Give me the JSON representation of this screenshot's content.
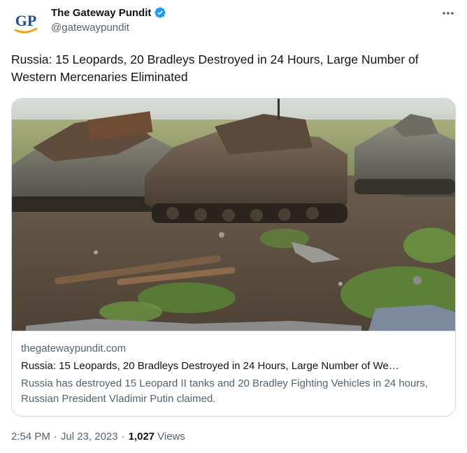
{
  "author": {
    "avatar_text": "GP",
    "display_name": "The Gateway Pundit",
    "handle": "@gatewaypundit",
    "verified_icon": "verified-badge-icon",
    "verified_color": "#1d9bf0"
  },
  "more_icon": "more-dots-icon",
  "tweet": {
    "text": "Russia: 15 Leopards, 20 Bradleys Destroyed in 24 Hours, Large Number of Western Mercenaries Eliminated"
  },
  "card": {
    "image": "photo of destroyed armored vehicles in a field",
    "domain": "thegatewaypundit.com",
    "title": "Russia: 15 Leopards, 20 Bradleys Destroyed in 24 Hours, Large Number of We…",
    "description": "Russia has destroyed 15 Leopard II tanks and 20 Bradley Fighting Vehicles in 24 hours, Russian President Vladimir Putin claimed."
  },
  "meta": {
    "time": "2:54 PM",
    "separator": "·",
    "date": "Jul 23, 2023",
    "views_count": "1,027",
    "views_label": "Views"
  },
  "colors": {
    "text_primary": "#0f1419",
    "text_secondary": "#536471",
    "border": "#cfd9de",
    "brand_blue": "#1d4f91",
    "brand_orange": "#f0a41c"
  }
}
